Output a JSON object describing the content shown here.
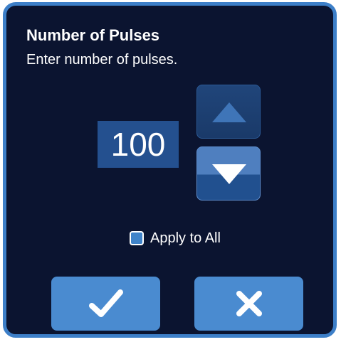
{
  "dialog": {
    "title": "Number of Pulses",
    "subtitle": "Enter number of pulses."
  },
  "value": {
    "display": "100"
  },
  "stepper": {
    "up_icon": "triangle-up-icon",
    "down_icon": "triangle-down-icon"
  },
  "apply_all": {
    "label": "Apply to All",
    "checked": true
  },
  "actions": {
    "confirm_icon": "checkmark-icon",
    "cancel_icon": "x-icon"
  },
  "colors": {
    "background": "#0b1430",
    "border": "#3d7fc8",
    "value_box": "#24508f",
    "button": "#4a8bd0",
    "text": "#ffffff"
  }
}
